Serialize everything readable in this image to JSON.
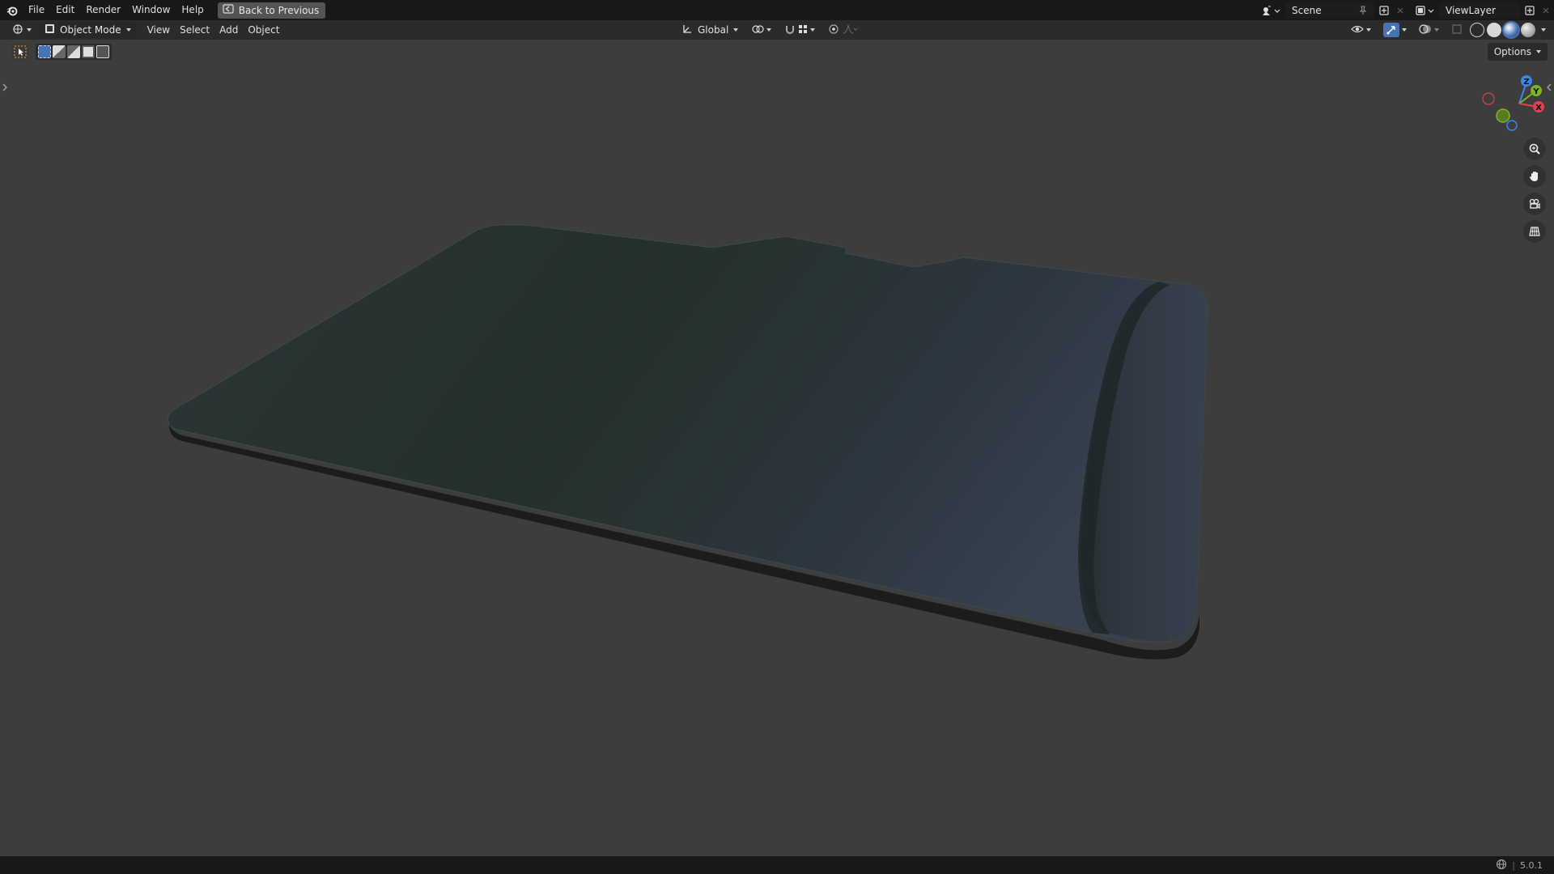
{
  "menu": {
    "file": "File",
    "edit": "Edit",
    "render": "Render",
    "window": "Window",
    "help": "Help",
    "back_to_previous": "Back to Previous"
  },
  "topbar_right": {
    "scene": "Scene",
    "view_layer": "ViewLayer"
  },
  "header": {
    "mode": "Object Mode",
    "view": "View",
    "select": "Select",
    "add": "Add",
    "object": "Object",
    "orientation": "Global"
  },
  "viewport": {
    "options": "Options"
  },
  "gizmo": {
    "x_label": "X",
    "y_label": "Y",
    "z_label": "Z"
  },
  "status": {
    "version": "5.0.1"
  },
  "colors": {
    "axis_x": "#e0434f",
    "axis_y": "#7fb429",
    "axis_z": "#3a87e8",
    "accent": "#4772b3"
  },
  "icons": {
    "logo": "blender-logo-icon",
    "zoom": "zoom-icon",
    "pan": "hand-icon",
    "camera": "camera-icon",
    "grid": "grid-icon"
  }
}
